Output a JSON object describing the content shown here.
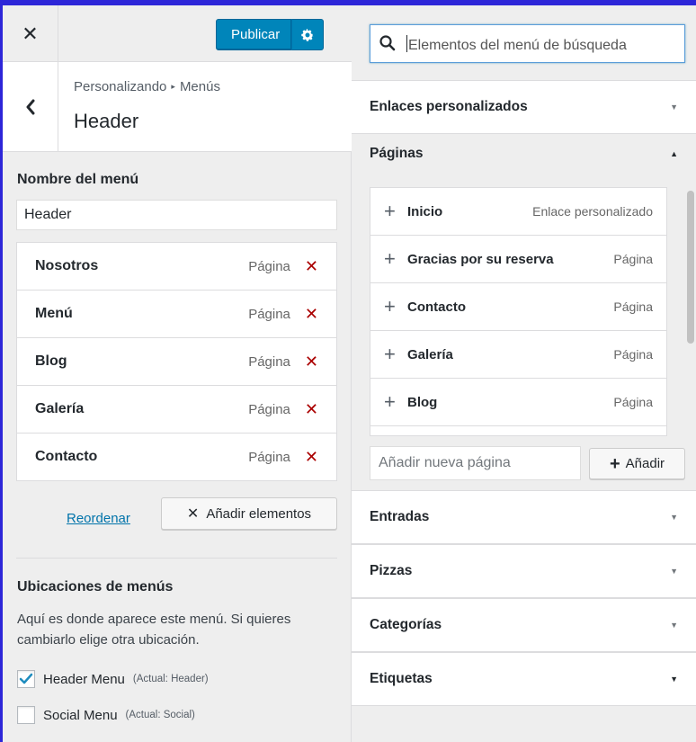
{
  "toolbar": {
    "close_icon": "close-icon",
    "publish_label": "Publicar",
    "settings_icon": "gear-icon"
  },
  "section": {
    "breadcrumb_root": "Personalizando",
    "breadcrumb_sep_icon": "triangle-right-icon",
    "breadcrumb_child": "Menús",
    "title": "Header"
  },
  "menu": {
    "name_label": "Nombre del menú",
    "name_value": "Header",
    "items": [
      {
        "title": "Nosotros",
        "type": "Página"
      },
      {
        "title": "Menú",
        "type": "Página"
      },
      {
        "title": "Blog",
        "type": "Página"
      },
      {
        "title": "Galería",
        "type": "Página"
      },
      {
        "title": "Contacto",
        "type": "Página"
      }
    ],
    "reorder_label": "Reordenar",
    "add_items_label": "Añadir elementos"
  },
  "locations": {
    "title": "Ubicaciones de menús",
    "description": "Aquí es donde aparece este menú. Si quieres cambiarlo elige otra ubicación.",
    "options": [
      {
        "label": "Header Menu",
        "current": "(Actual: Header)",
        "checked": true
      },
      {
        "label": "Social Menu",
        "current": "(Actual: Social)",
        "checked": false
      }
    ]
  },
  "right": {
    "search_placeholder": "Elementos del menú de búsqueda",
    "custom_links_title": "Enlaces personalizados",
    "pages_title": "Páginas",
    "pages": [
      {
        "title": "Inicio",
        "type": "Enlace personalizado"
      },
      {
        "title": "Gracias por su reserva",
        "type": "Página"
      },
      {
        "title": "Contacto",
        "type": "Página"
      },
      {
        "title": "Galería",
        "type": "Página"
      },
      {
        "title": "Blog",
        "type": "Página"
      }
    ],
    "new_page_placeholder": "Añadir nueva página",
    "add_page_label": "Añadir",
    "sections": [
      "Entradas",
      "Pizzas",
      "Categorías",
      "Etiquetas"
    ]
  },
  "colors": {
    "primary": "#0085ba",
    "remove": "#aa0000",
    "link": "#0073aa",
    "outer_border": "#2d26d8"
  }
}
